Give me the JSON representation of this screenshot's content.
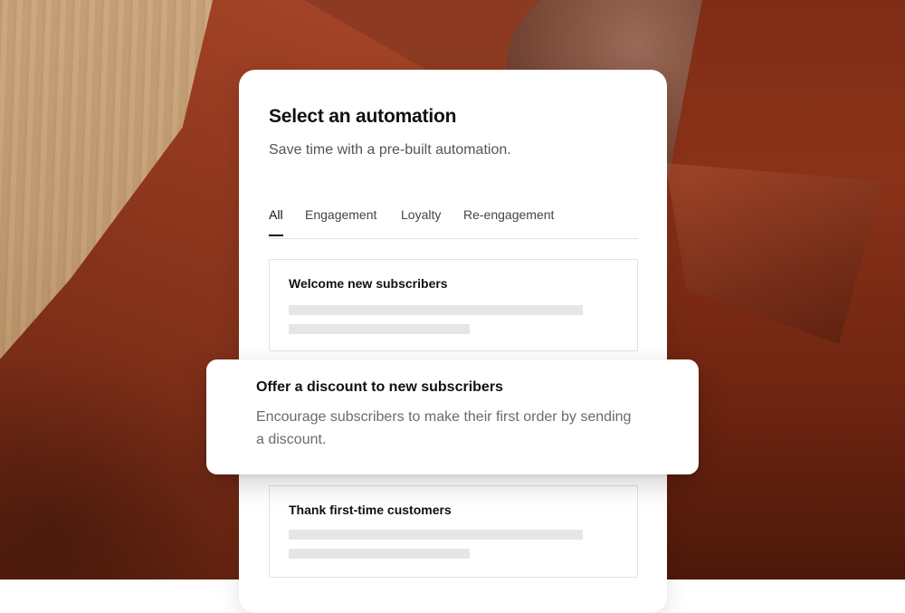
{
  "header": {
    "title": "Select an automation",
    "subtitle": "Save time with a pre-built automation."
  },
  "tabs": [
    {
      "label": "All",
      "active": true
    },
    {
      "label": "Engagement",
      "active": false
    },
    {
      "label": "Loyalty",
      "active": false
    },
    {
      "label": "Re-engagement",
      "active": false
    }
  ],
  "automations": [
    {
      "title": "Welcome new subscribers"
    },
    {
      "title": "Thank first-time customers"
    }
  ],
  "highlighted": {
    "title": "Offer a discount to new subscribers",
    "description": "Encourage subscribers to make their first order by sending a discount."
  },
  "colors": {
    "accent": "#111111",
    "jacket": "#8d3a22",
    "wood": "#c29c72"
  }
}
